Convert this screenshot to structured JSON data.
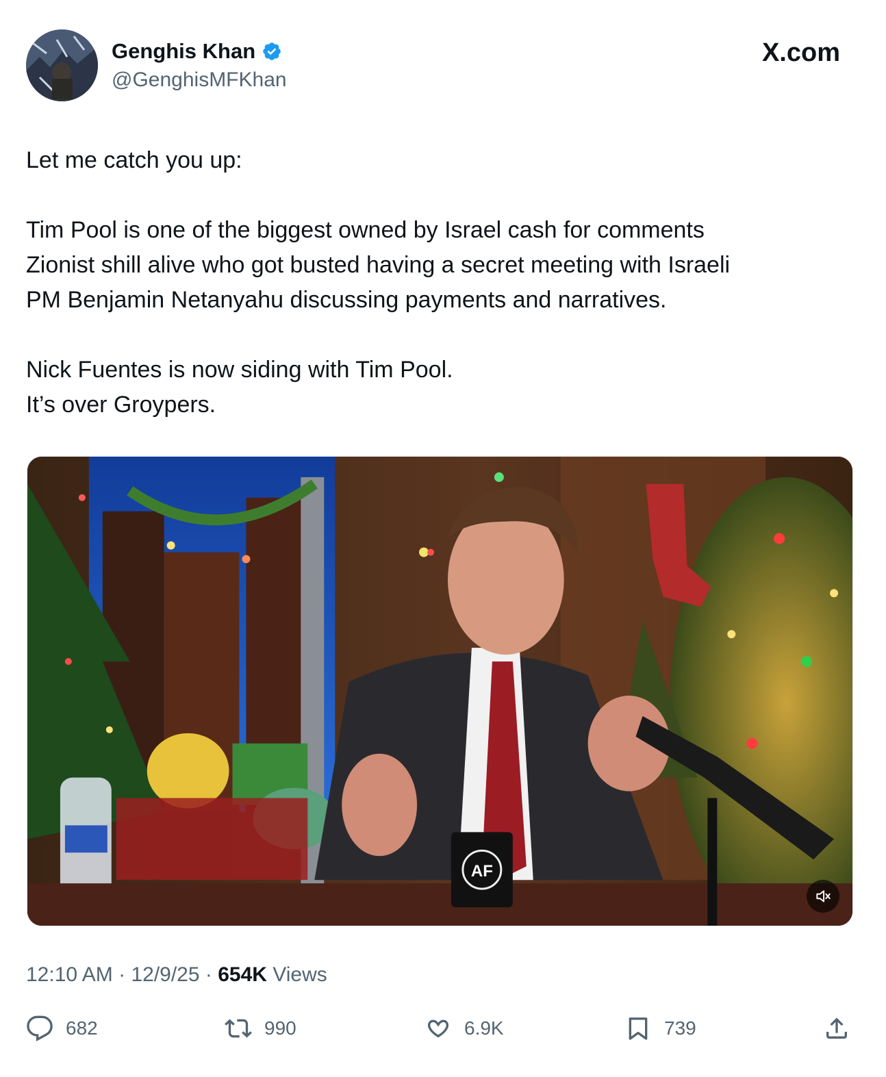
{
  "author": {
    "display_name": "Genghis Khan",
    "handle": "@GenghisMFKhan",
    "verified": true,
    "avatar_icon": "profile-avatar"
  },
  "site_mark": "X.com",
  "tweet": {
    "paragraphs": [
      "Let me catch you up:",
      "Tim Pool is one of the biggest owned by Israel cash for comments\nZionist shill alive who got busted having a secret meeting with Israeli\nPM Benjamin Netanyahu discussing payments and narratives.",
      "Nick Fuentes is now siding with Tim Pool.\nIt’s over Groypers."
    ]
  },
  "media": {
    "type": "video",
    "mug_text": "AF",
    "mute_icon": "speaker-muted-icon"
  },
  "meta": {
    "time": "12:10 AM",
    "separator": "·",
    "date": "12/9/25",
    "views_count": "654K",
    "views_label": "Views"
  },
  "actions": {
    "replies": "682",
    "reposts": "990",
    "likes": "6.9K",
    "bookmarks": "739"
  },
  "colors": {
    "text": "#0f1419",
    "secondary_text": "#536471",
    "verified_badge": "#1d9bf0"
  }
}
